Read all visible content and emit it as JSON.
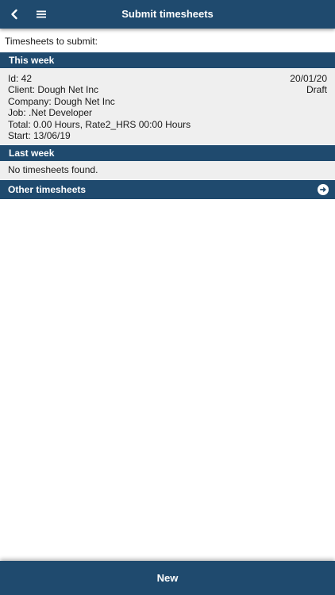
{
  "header": {
    "title": "Submit timesheets",
    "back_icon": "chevron-left-icon",
    "menu_icon": "hamburger-menu-icon"
  },
  "intro_text": "Timesheets to submit:",
  "sections": {
    "this_week": {
      "label": "This week",
      "timesheets": [
        {
          "id": "Id: 42",
          "date": "20/01/20",
          "client": "Client: Dough Net Inc",
          "status": "Draft",
          "company": "Company: Dough Net Inc",
          "job": "Job: .Net Developer",
          "total": "Total: 0.00 Hours, Rate2_HRS 00:00 Hours",
          "start": "Start: 13/06/19"
        }
      ]
    },
    "last_week": {
      "label": "Last week",
      "empty_message": "No timesheets found."
    },
    "other": {
      "label": "Other timesheets",
      "icon": "arrow-right-circle-icon"
    }
  },
  "footer": {
    "new_label": "New"
  },
  "colors": {
    "bar": "#1f4a6e",
    "card_bg": "#efefef",
    "text": "#1a1a1a"
  }
}
